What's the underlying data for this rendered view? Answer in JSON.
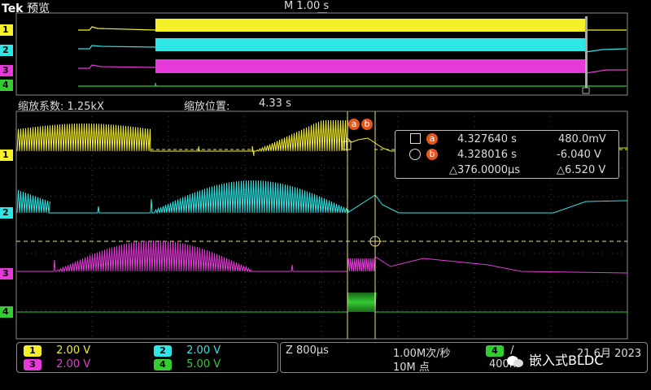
{
  "header": {
    "brand": "Tek",
    "mode": "预览",
    "time_scale": "M 1.00 s"
  },
  "zoom": {
    "factor_label": "缩放系数: 1.25kX",
    "position_label": "缩放位置:",
    "position_value": "4.33 s"
  },
  "cursors": {
    "labels": [
      "a",
      "b"
    ],
    "a": {
      "time": "4.327640 s",
      "value": "480.0mV"
    },
    "b": {
      "time": "4.328016 s",
      "value": "-6.040 V"
    },
    "delta": {
      "time": "△376.0000μs",
      "value": "△6.520 V"
    }
  },
  "channels": [
    {
      "id": "1",
      "color": "#f5f02a",
      "scale": "2.00 V"
    },
    {
      "id": "2",
      "color": "#2ee6e6",
      "scale": "2.00 V"
    },
    {
      "id": "3",
      "color": "#e53ad9",
      "scale": "2.00 V"
    },
    {
      "id": "4",
      "color": "#33cc33",
      "scale": "5.00 V"
    }
  ],
  "acquisition": {
    "zoom_timebase": "Z 800μs",
    "sample_rate": "1.00M次/秒",
    "record_length": "10M 点",
    "trigger_channel": "4",
    "trigger_level": "400m",
    "date": "21 6月 2023"
  },
  "watermark": "嵌入式BLDC"
}
